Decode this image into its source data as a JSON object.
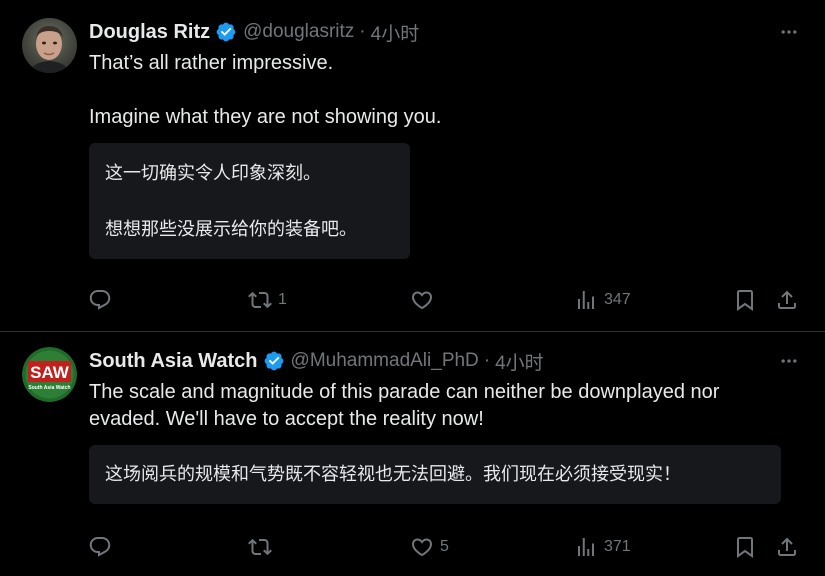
{
  "tweets": [
    {
      "author": {
        "display_name": "Douglas Ritz",
        "handle": "@douglasritz",
        "verified": true
      },
      "time": "4小时",
      "separator": "·",
      "text": "That’s all rather impressive.\n\nImagine what they are not showing you.",
      "translation": "这一切确实令人印象深刻。\n\n想想那些没展示给你的装备吧。",
      "stats": {
        "replies": "",
        "retweets": "1",
        "likes": "",
        "views": "347"
      }
    },
    {
      "author": {
        "display_name": "South Asia Watch",
        "handle": "@MuhammadAli_PhD",
        "verified": true,
        "avatar_text": "SAW",
        "avatar_subtext": "South Asia Watch"
      },
      "time": "4小时",
      "separator": "·",
      "text": "The scale and magnitude of this parade can neither be downplayed nor evaded. We'll have to accept the reality now!",
      "translation": "这场阅兵的规模和气势既不容轻视也无法回避。我们现在必须接受现实！",
      "stats": {
        "replies": "",
        "retweets": "",
        "likes": "5",
        "views": "371"
      }
    }
  ],
  "colors": {
    "background": "#000000",
    "text": "#e7e9ea",
    "muted": "#71767b",
    "verified": "#1d9bf0",
    "divider": "#2f3336",
    "translation_bg": "#16181c"
  },
  "icons": [
    "verified-badge-icon",
    "more-icon",
    "reply-icon",
    "retweet-icon",
    "like-icon",
    "views-icon",
    "bookmark-icon",
    "share-icon"
  ]
}
